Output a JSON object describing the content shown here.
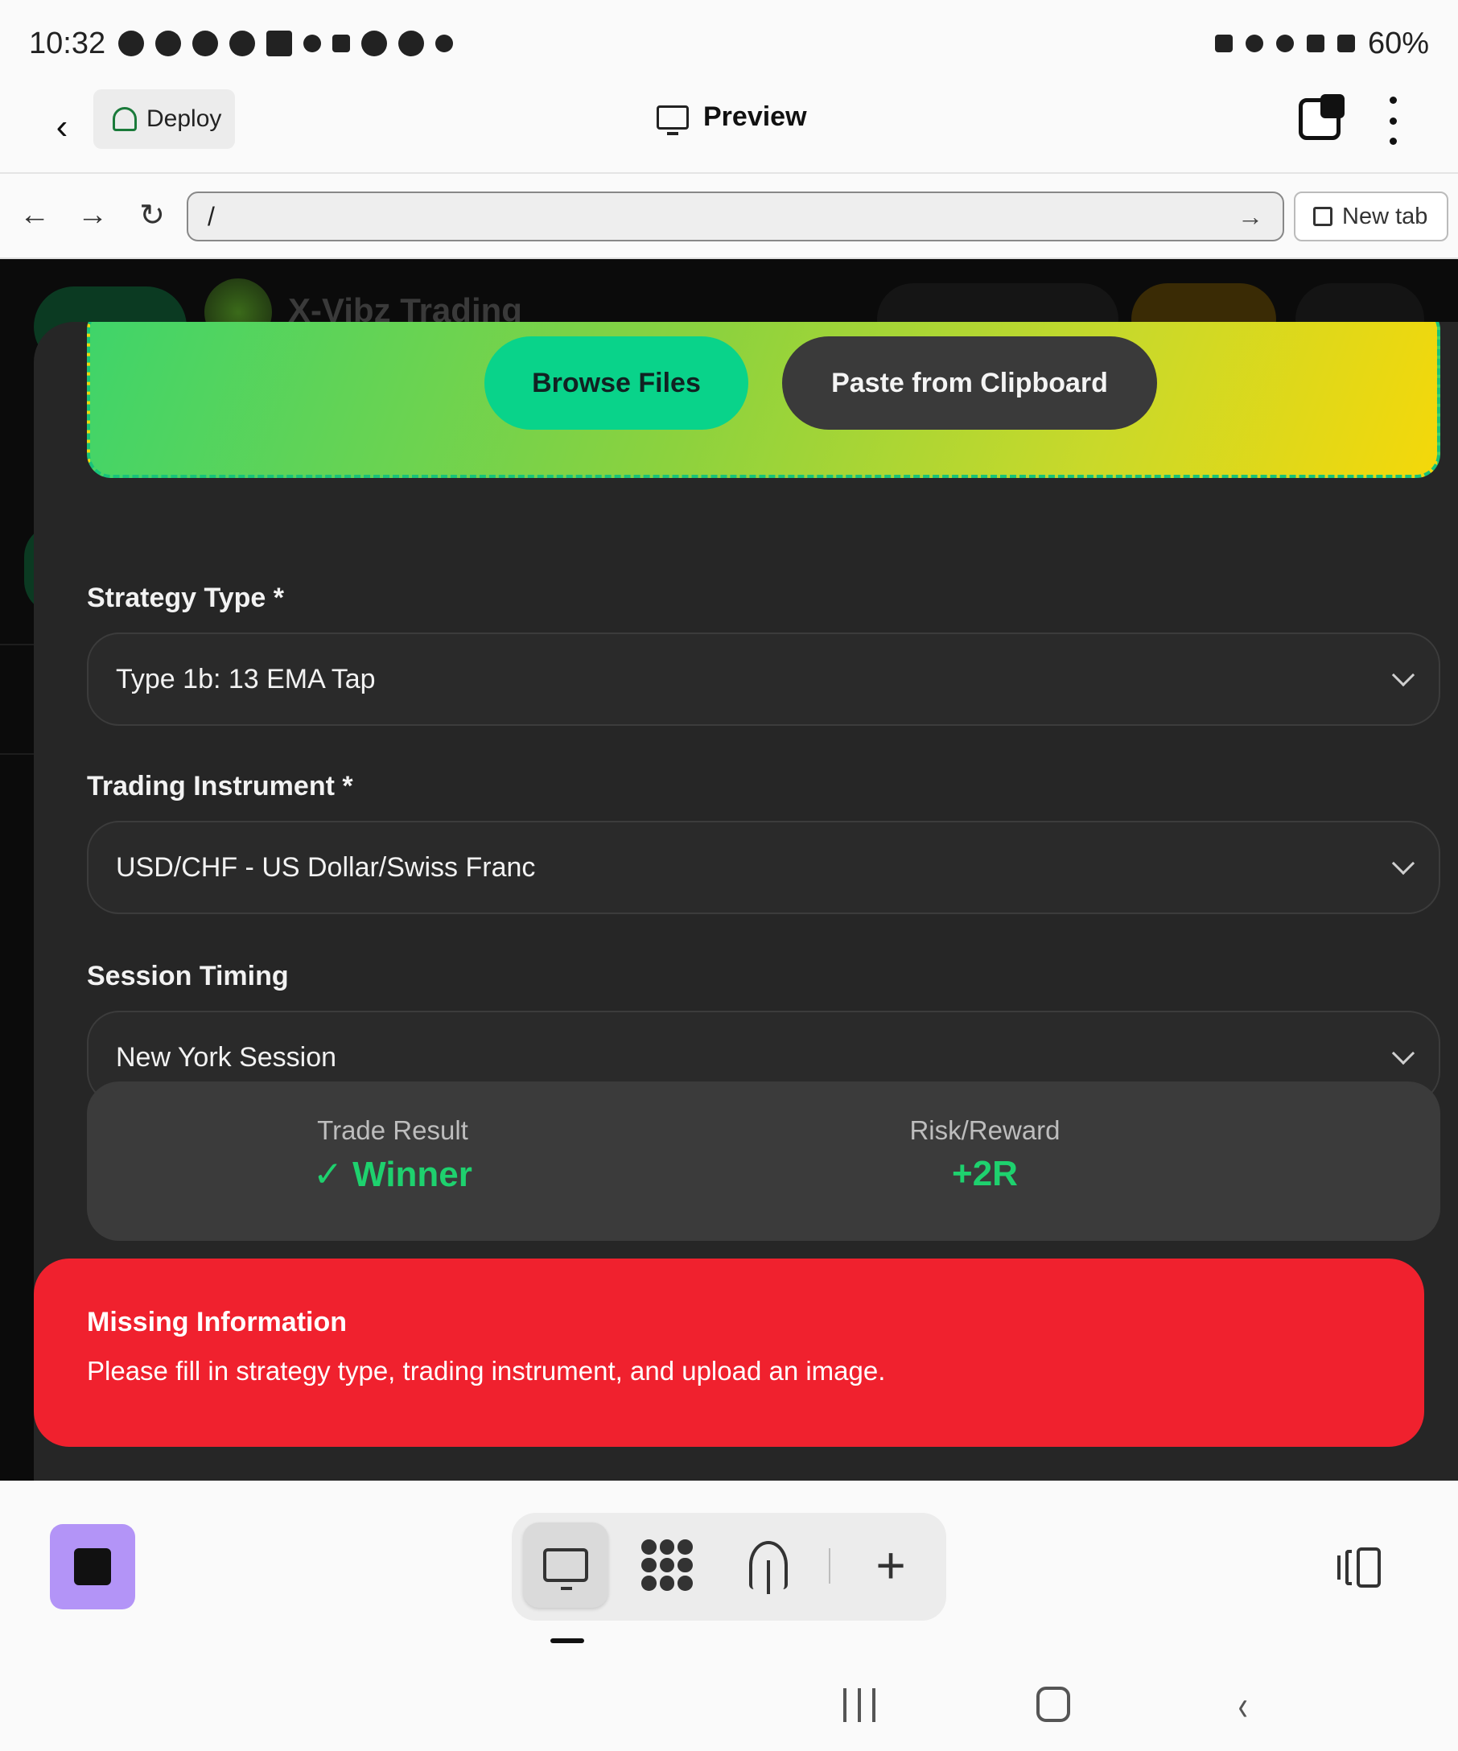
{
  "status_bar": {
    "time": "10:32",
    "battery": "60%",
    "icons": [
      "messenger-icon",
      "facebook-icon",
      "facebook-icon",
      "pinterest-icon",
      "myq-icon",
      "wave-icon",
      "dots-icon",
      "tree-icon",
      "facebook-icon",
      "cloud-icon",
      "battery-saver-icon",
      "alarm-icon",
      "bluetooth-icon",
      "5g-icon",
      "signal-icon"
    ]
  },
  "app_header": {
    "deploy_label": "Deploy",
    "title": "Preview"
  },
  "browser": {
    "url": "/",
    "new_tab_label": "New tab"
  },
  "background_page": {
    "title": "X-Vibz Trading"
  },
  "upload": {
    "browse_label": "Browse Files",
    "paste_label": "Paste from Clipboard"
  },
  "form": {
    "strategy_label": "Strategy Type *",
    "strategy_value": "Type 1b: 13 EMA Tap",
    "instrument_label": "Trading Instrument *",
    "instrument_value": "USD/CHF - US Dollar/Swiss Franc",
    "session_label": "Session Timing",
    "session_value": "New York Session"
  },
  "result": {
    "trade_result_label": "Trade Result",
    "trade_result_value": "✓ Winner",
    "risk_reward_label": "Risk/Reward",
    "risk_reward_value": "+2R",
    "accent_color": "#1ed16e"
  },
  "toast": {
    "title": "Missing Information",
    "message": "Please fill in strategy type, trading instrument, and upload an image.",
    "color": "#f0212e"
  },
  "toolbar": {
    "items": [
      "monitor-icon",
      "molecule-icon",
      "antenna-icon",
      "plus-icon"
    ],
    "active_item": "monitor-icon",
    "stop_color": "#b394f7"
  }
}
